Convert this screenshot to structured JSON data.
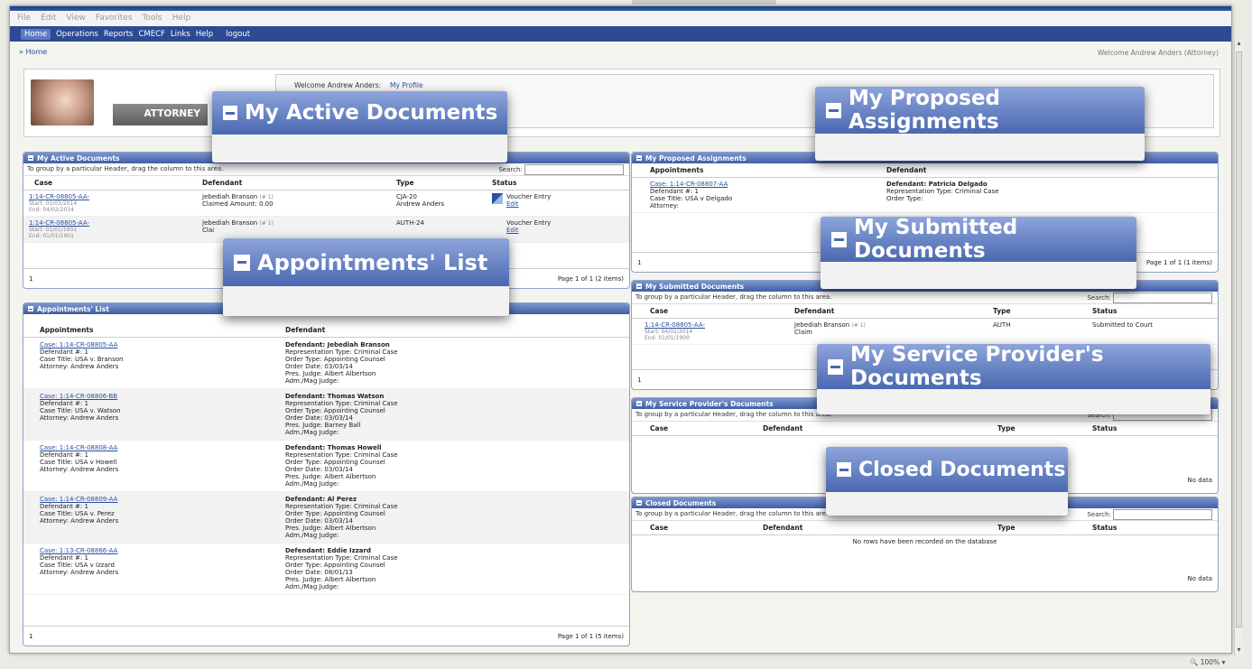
{
  "browser_menu": [
    "File",
    "Edit",
    "View",
    "Favorites",
    "Tools",
    "Help"
  ],
  "nav": {
    "items": [
      "Home",
      "Operations",
      "Reports",
      "CMECF",
      "Links",
      "Help"
    ],
    "logout": "logout"
  },
  "breadcrumb": "» Home",
  "welcome_right": "Welcome Andrew Anders (Attorney)",
  "header": {
    "role": "ATTORNEY",
    "welcome": "Welcome Andrew Anders:",
    "profile_link": "My Profile"
  },
  "group_hint": "To group by a particular Header, drag the column to this area.",
  "search_label": "Search:",
  "active_docs": {
    "title": "My Active Documents",
    "columns": [
      "Case",
      "Defendant",
      "Type",
      "Status"
    ],
    "rows": [
      {
        "case": "1:14-CR-08805-AA-",
        "start": "Start: 03/03/2014",
        "end": "End: 04/02/2014",
        "defendant": "Jebediah Branson",
        "def_num": "(# 1)",
        "amount": "Claimed Amount: 0.00",
        "type": "CJA-20",
        "type2": "Andrew Anders",
        "status": "Voucher Entry",
        "action": "Edit"
      },
      {
        "case": "1:14-CR-08805-AA-",
        "start": "Start: 01/01/1901",
        "end": "End: 01/01/1901",
        "defendant": "Jebediah Branson",
        "def_num": "(# 1)",
        "amount": "Clai",
        "type": "AUTH-24",
        "type2": "",
        "status": "Voucher Entry",
        "action": "Edit"
      }
    ],
    "page_num": "1",
    "pager": "Page 1 of 1 (2 items)"
  },
  "appointments": {
    "title": "Appointments' List",
    "columns": [
      "Appointments",
      "Defendant"
    ],
    "rows": [
      {
        "case": "Case: 1:14-CR-08805-AA",
        "defnum": "Defendant #: 1",
        "title": "Case Title: USA v. Branson",
        "atty": "Attorney: Andrew Anders",
        "def": "Defendant: Jebediah Branson",
        "rep": "Representation Type: Criminal Case",
        "order": "Order Type: Appointing Counsel",
        "date": "Order Date: 03/03/14",
        "judge": "Pres. Judge: Albert Albertson",
        "mag": "Adm./Mag Judge:"
      },
      {
        "case": "Case: 1:14-CR-08806-BB",
        "defnum": "Defendant #: 1",
        "title": "Case Title: USA v. Watson",
        "atty": "Attorney: Andrew Anders",
        "def": "Defendant: Thomas Watson",
        "rep": "Representation Type: Criminal Case",
        "order": "Order Type: Appointing Counsel",
        "date": "Order Date: 03/03/14",
        "judge": "Pres. Judge: Barney Ball",
        "mag": "Adm./Mag Judge:"
      },
      {
        "case": "Case: 1:14-CR-08808-AA",
        "defnum": "Defendant #: 1",
        "title": "Case Title: USA v Howell",
        "atty": "Attorney: Andrew Anders",
        "def": "Defendant: Thomas Howell",
        "rep": "Representation Type: Criminal Case",
        "order": "Order Type: Appointing Counsel",
        "date": "Order Date: 03/03/14",
        "judge": "Pres. Judge: Albert Albertson",
        "mag": "Adm./Mag Judge:"
      },
      {
        "case": "Case: 1:14-CR-08809-AA",
        "defnum": "Defendant #: 1",
        "title": "Case Title: USA v. Perez",
        "atty": "Attorney: Andrew Anders",
        "def": "Defendant: Al Perez",
        "rep": "Representation Type: Criminal Case",
        "order": "Order Type: Appointing Counsel",
        "date": "Order Date: 03/03/14",
        "judge": "Pres. Judge: Albert Albertson",
        "mag": "Adm./Mag Judge:"
      },
      {
        "case": "Case: 1:13-CR-08866-AA",
        "defnum": "Defendant #: 1",
        "title": "Case Title: USA v Izzard",
        "atty": "Attorney: Andrew Anders",
        "def": "Defendant: Eddie Izzard",
        "rep": "Representation Type: Criminal Case",
        "order": "Order Type: Appointing Counsel",
        "date": "Order Date: 08/01/13",
        "judge": "Pres. Judge: Albert Albertson",
        "mag": "Adm./Mag Judge:"
      }
    ],
    "page_num": "1",
    "pager": "Page 1 of 1 (5 items)"
  },
  "proposed": {
    "title": "My Proposed Assignments",
    "columns": [
      "Appointments",
      "Defendant"
    ],
    "row": {
      "case": "Case: 1:14-CR-08807-AA",
      "defnum": "Defendant #: 1",
      "title": "Case Title: USA v Delgado",
      "atty": "Attorney:",
      "def": "Defendant: Patricia Delgado",
      "rep": "Representation Type: Criminal Case",
      "order": "Order Type:"
    },
    "page_num": "1",
    "pager": "Page 1 of 1 (1 items)"
  },
  "submitted": {
    "title": "My Submitted Documents",
    "columns": [
      "Case",
      "Defendant",
      "Type",
      "Status"
    ],
    "row": {
      "case": "1:14-CR-08805-AA-",
      "start": "Start: 04/02/2014",
      "end": "End: 01/01/1900",
      "defendant": "Jebediah Branson",
      "def_num": "(# 1)",
      "amount": "Claim",
      "type": "AUTH",
      "status": "Submitted to Court"
    },
    "page_num": "1"
  },
  "service": {
    "title": "My Service Provider's Documents",
    "columns": [
      "Case",
      "Defendant",
      "Type",
      "Status"
    ],
    "nodata": "No data"
  },
  "closed": {
    "title": "Closed Documents",
    "columns": [
      "Case",
      "Defendant",
      "Type",
      "Status"
    ],
    "norows": "No rows have been recorded on the database",
    "nodata": "No data"
  },
  "callouts": {
    "active": "My Active Documents",
    "proposed": "My Proposed Assignments",
    "appointments": "Appointments' List",
    "submitted": "My Submitted Documents",
    "service": "My Service Provider's Documents",
    "closed": "Closed Documents"
  },
  "zoom": "100%"
}
